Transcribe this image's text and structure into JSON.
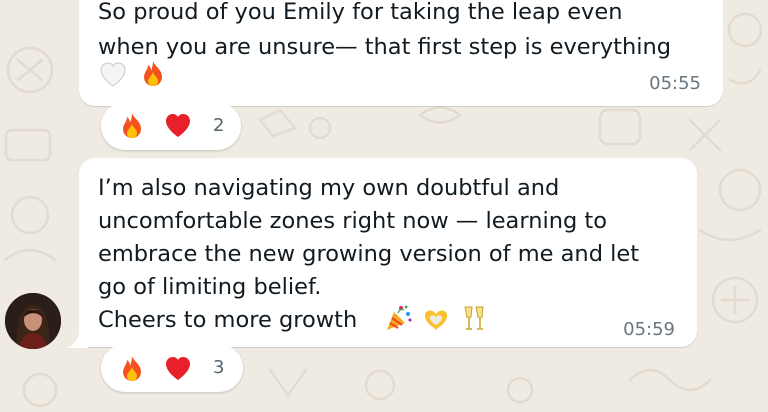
{
  "colors": {
    "wallpaper": "#efeae2",
    "bubble": "#ffffff",
    "text": "#111b21",
    "timestamp": "#667781"
  },
  "messages": [
    {
      "lines": [
        "So proud of you Emily for taking the leap even",
        "when you are unsure— that first step is everything"
      ],
      "inline_emojis": [
        "white-heart-icon",
        "fire-icon"
      ],
      "time": "05:55",
      "reactions": {
        "emojis": [
          "fire-icon",
          "red-heart-icon"
        ],
        "count": "2"
      }
    },
    {
      "lines": [
        "I’m also navigating my own doubtful and",
        "uncomfortable zones right now — learning to",
        "embrace the new growing version of me and let",
        "go of limiting belief.",
        "Cheers to more growth"
      ],
      "inline_emojis": [
        "party-popper-icon",
        "heart-hands-icon",
        "clinking-glasses-icon"
      ],
      "time": "05:59",
      "reactions": {
        "emojis": [
          "fire-icon",
          "red-heart-icon"
        ],
        "count": "3"
      }
    }
  ]
}
